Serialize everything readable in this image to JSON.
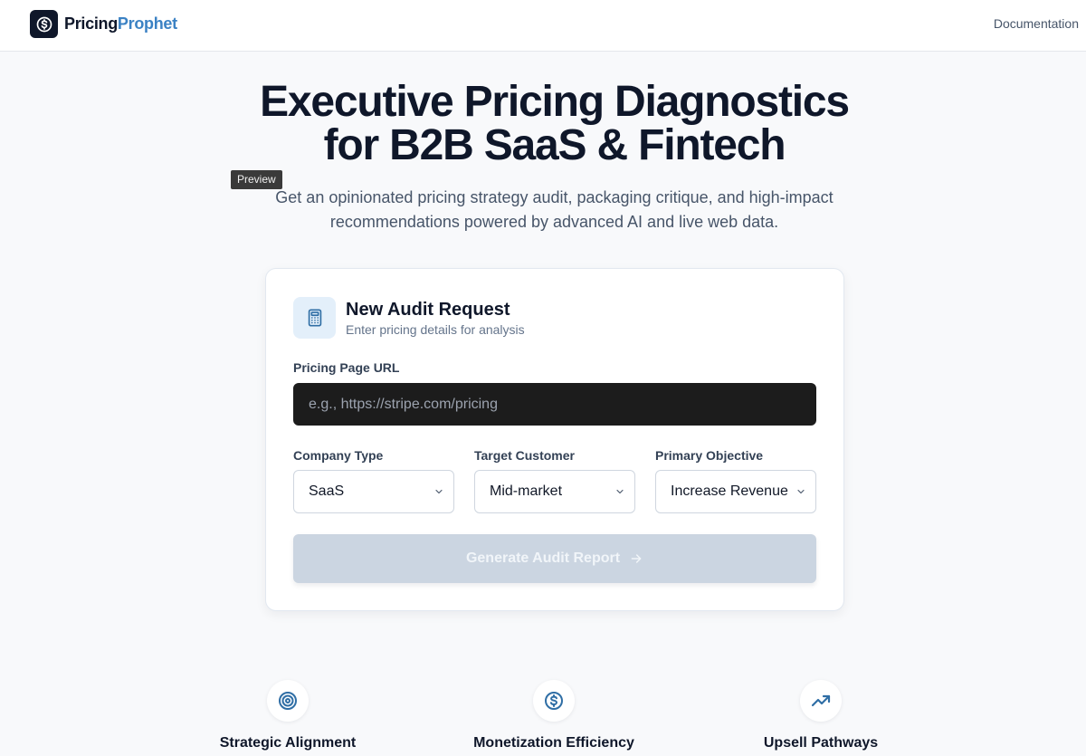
{
  "header": {
    "brand_part1": "Pricing",
    "brand_part2": "Prophet",
    "logo_icon": "dollar-circle-icon",
    "documentation_link": "Documentation"
  },
  "hero": {
    "title_line1": "Executive Pricing Diagnostics",
    "title_line2": "for B2B SaaS & Fintech",
    "preview_tag": "Preview",
    "subtitle_line1": "Get an opinionated pricing strategy audit, packaging critique, and high-impact",
    "subtitle_line2": "recommendations powered by advanced AI and live web data."
  },
  "card": {
    "icon": "calculator-icon",
    "title": "New Audit Request",
    "subtitle": "Enter pricing details for analysis",
    "url_label": "Pricing Page URL",
    "url_value": "",
    "url_placeholder": "e.g., https://stripe.com/pricing",
    "company_type": {
      "label": "Company Type",
      "value": "SaaS"
    },
    "target_customer": {
      "label": "Target Customer",
      "value": "Mid-market"
    },
    "primary_objective": {
      "label": "Primary Objective",
      "value": "Increase Revenue"
    },
    "submit_label": "Generate Audit Report",
    "submit_disabled": true
  },
  "features": [
    {
      "icon": "target-icon",
      "title": "Strategic Alignment"
    },
    {
      "icon": "dollar-circle-icon",
      "title": "Monetization Efficiency"
    },
    {
      "icon": "trending-up-icon",
      "title": "Upsell Pathways"
    }
  ],
  "colors": {
    "primary_dark": "#0f172a",
    "accent_blue": "#3b82c4",
    "disabled_button": "#cbd5e1",
    "input_dark": "#1c1c1c"
  }
}
